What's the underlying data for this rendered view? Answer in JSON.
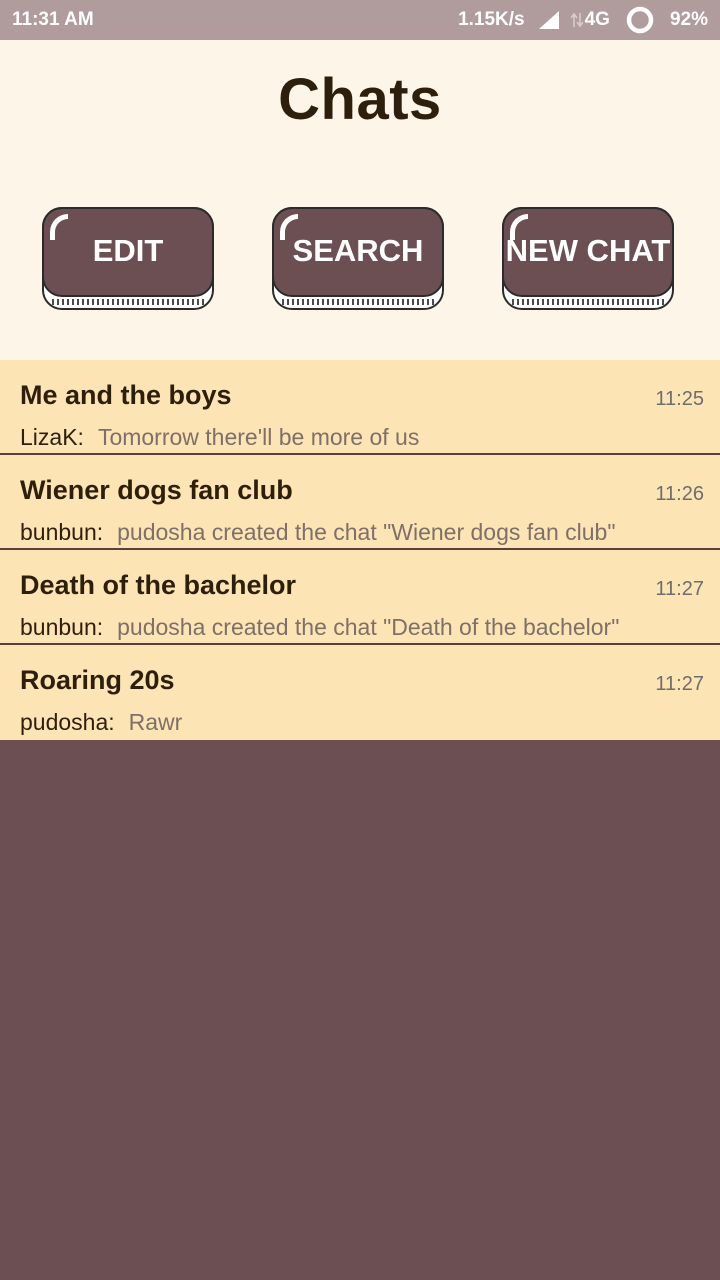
{
  "status_bar": {
    "time": "11:31 AM",
    "net_speed": "1.15K/s",
    "network_type": "4G",
    "battery": "92%",
    "icons": [
      "signal-icon",
      "data-arrows-icon",
      "battery-icon"
    ]
  },
  "header": {
    "title": "Chats",
    "buttons": {
      "edit": "EDIT",
      "search": "SEARCH",
      "new_chat": "NEW CHAT"
    }
  },
  "chats": [
    {
      "name": "Me and the boys",
      "time": "11:25",
      "sender": "LizaK:",
      "message": "Tomorrow there'll be more of us"
    },
    {
      "name": "Wiener dogs fan club",
      "time": "11:26",
      "sender": "bunbun:",
      "message": "pudosha created the chat \"Wiener dogs fan club\""
    },
    {
      "name": "Death of the bachelor",
      "time": "11:27",
      "sender": "bunbun:",
      "message": "pudosha created the chat \"Death of the bachelor\""
    },
    {
      "name": "Roaring 20s",
      "time": "11:27",
      "sender": "pudosha:",
      "message": "Rawr"
    }
  ],
  "colors": {
    "status_bar": "#b09c9d",
    "header_bg": "#fdf6e8",
    "chat_bg": "#fde4b5",
    "accent": "#6b4f52",
    "title_text": "#2e1f0d"
  }
}
